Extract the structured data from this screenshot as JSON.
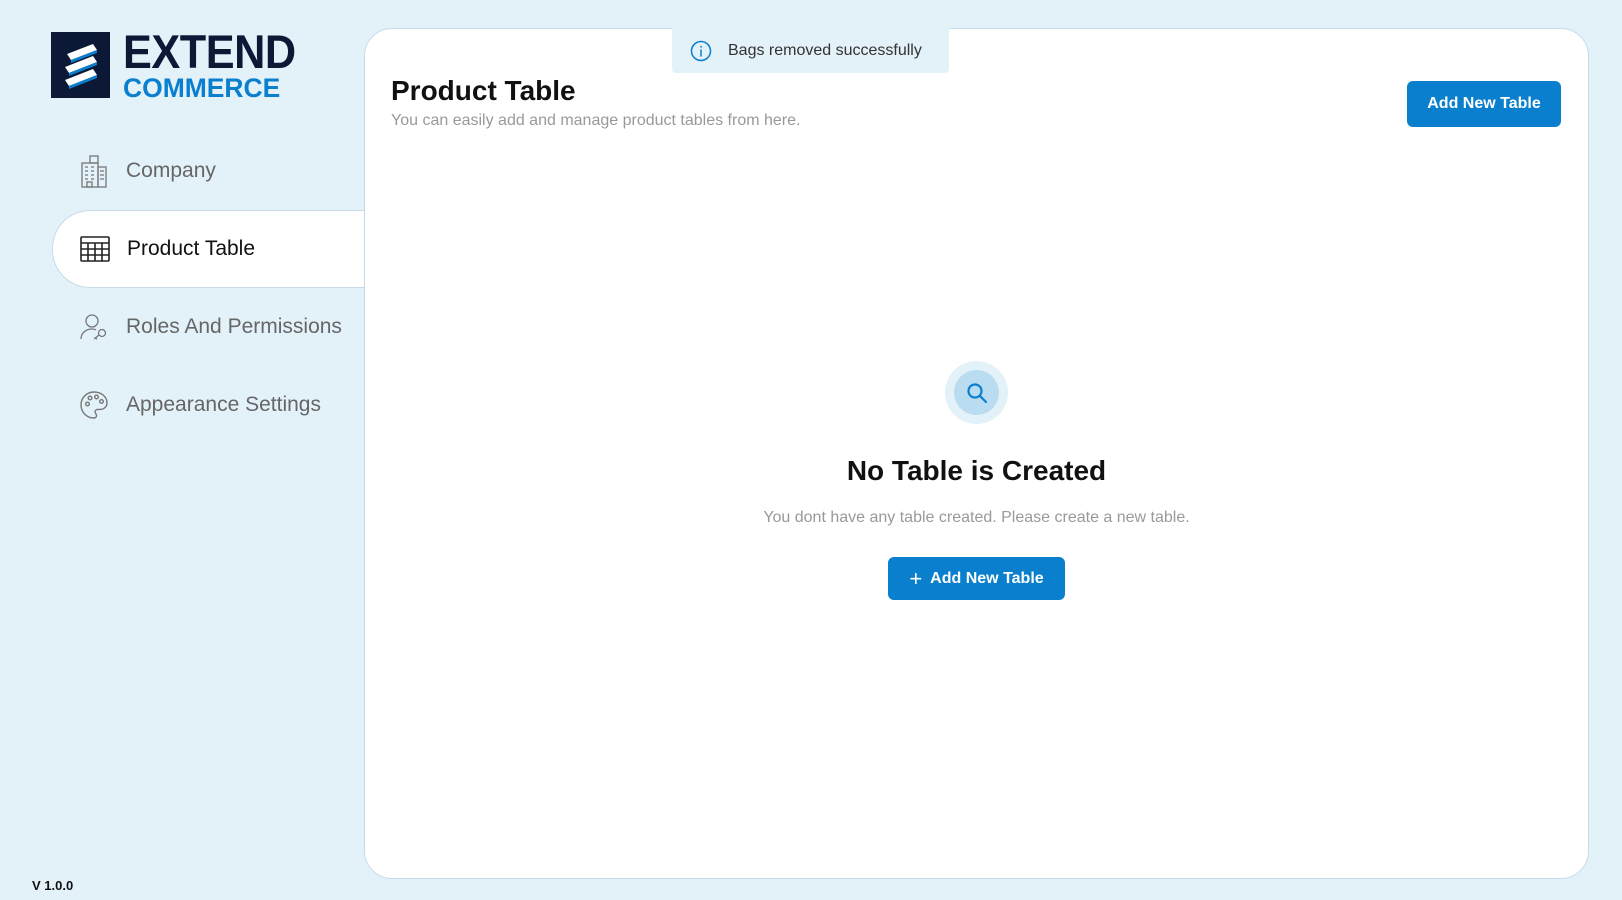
{
  "brand": {
    "line1": "EXTEND",
    "line2": "COMMERCE",
    "logo_icon": "stacked-stripes-icon",
    "colors": {
      "dark": "#0b1836",
      "accent": "#0a7fce"
    }
  },
  "sidebar": {
    "items": [
      {
        "label": "Company",
        "icon": "building-icon",
        "active": false
      },
      {
        "label": "Product Table",
        "icon": "table-grid-icon",
        "active": true
      },
      {
        "label": "Roles And Permissions",
        "icon": "user-key-icon",
        "active": false
      },
      {
        "label": "Appearance Settings",
        "icon": "palette-icon",
        "active": false
      }
    ],
    "version": "V 1.0.0"
  },
  "toast": {
    "icon": "info-icon",
    "message": "Bags removed successfully"
  },
  "main": {
    "title": "Product Table",
    "subtitle": "You can easily add and manage product tables from here.",
    "header_button_label": "Add New Table",
    "empty_state": {
      "icon": "search-icon",
      "title": "No Table is Created",
      "text": "You dont have any table created. Please create a new table.",
      "button_icon": "plus-icon",
      "button_label": "Add New Table"
    }
  }
}
